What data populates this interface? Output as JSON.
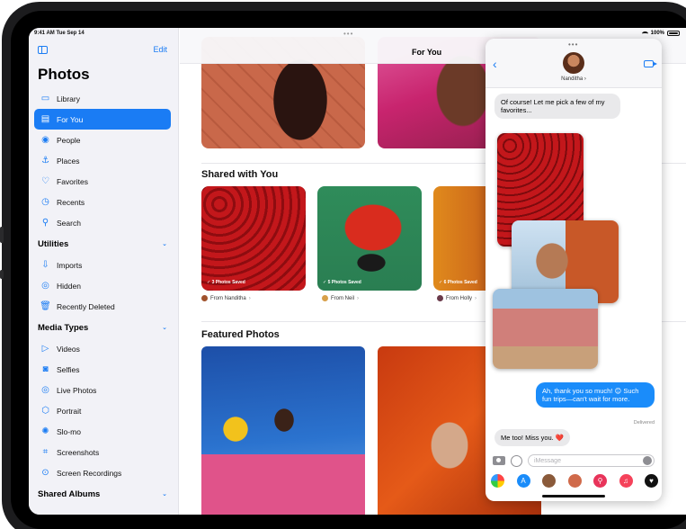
{
  "status": {
    "time": "9:41 AM  Tue Sep 14",
    "battery": "100%"
  },
  "sidebar": {
    "edit_label": "Edit",
    "title": "Photos",
    "items": [
      {
        "label": "Library",
        "icon": "library-icon",
        "glyph": "▭",
        "active": false
      },
      {
        "label": "For You",
        "icon": "for-you-icon",
        "glyph": "▤",
        "active": true
      },
      {
        "label": "People",
        "icon": "people-icon",
        "glyph": "◉",
        "active": false
      },
      {
        "label": "Places",
        "icon": "places-icon",
        "glyph": "⚓",
        "active": false
      },
      {
        "label": "Favorites",
        "icon": "heart-icon",
        "glyph": "♡",
        "active": false
      },
      {
        "label": "Recents",
        "icon": "clock-icon",
        "glyph": "◷",
        "active": false
      },
      {
        "label": "Search",
        "icon": "search-icon",
        "glyph": "⚲",
        "active": false
      }
    ],
    "utilities_label": "Utilities",
    "utilities": [
      {
        "label": "Imports",
        "icon": "import-icon",
        "glyph": "⇩"
      },
      {
        "label": "Hidden",
        "icon": "eye-icon",
        "glyph": "◎"
      },
      {
        "label": "Recently Deleted",
        "icon": "trash-icon",
        "glyph": "🗑"
      }
    ],
    "media_types_label": "Media Types",
    "media_types": [
      {
        "label": "Videos",
        "icon": "video-icon",
        "glyph": "▷"
      },
      {
        "label": "Selfies",
        "icon": "selfie-icon",
        "glyph": "◙"
      },
      {
        "label": "Live Photos",
        "icon": "live-photo-icon",
        "glyph": "◎"
      },
      {
        "label": "Portrait",
        "icon": "cube-icon",
        "glyph": "⬡"
      },
      {
        "label": "Slo-mo",
        "icon": "slomo-icon",
        "glyph": "✺"
      },
      {
        "label": "Screenshots",
        "icon": "screenshot-icon",
        "glyph": "⌗"
      },
      {
        "label": "Screen Recordings",
        "icon": "record-icon",
        "glyph": "⊙"
      }
    ],
    "shared_albums_label": "Shared Albums"
  },
  "main": {
    "title": "For You",
    "shared_with_you": {
      "title": "Shared with You",
      "cards": [
        {
          "saved": "✓ 3 Photos Saved",
          "from": "From Nanditha"
        },
        {
          "saved": "✓ 5 Photos Saved",
          "from": "From Neil"
        },
        {
          "saved": "✓ 6 Photos Saved",
          "from": "From Holly"
        }
      ]
    },
    "featured_title": "Featured Photos"
  },
  "messages": {
    "contact": "Nanditha",
    "bubble1": "Of course! Let me pick a few of my favorites...",
    "bubble2": "Ah, thank you so much! 😊 Such fun trips—can't wait for more.",
    "delivered": "Delivered",
    "bubble3": "Me too! Miss you. ❤️",
    "input_placeholder": "iMessage"
  }
}
